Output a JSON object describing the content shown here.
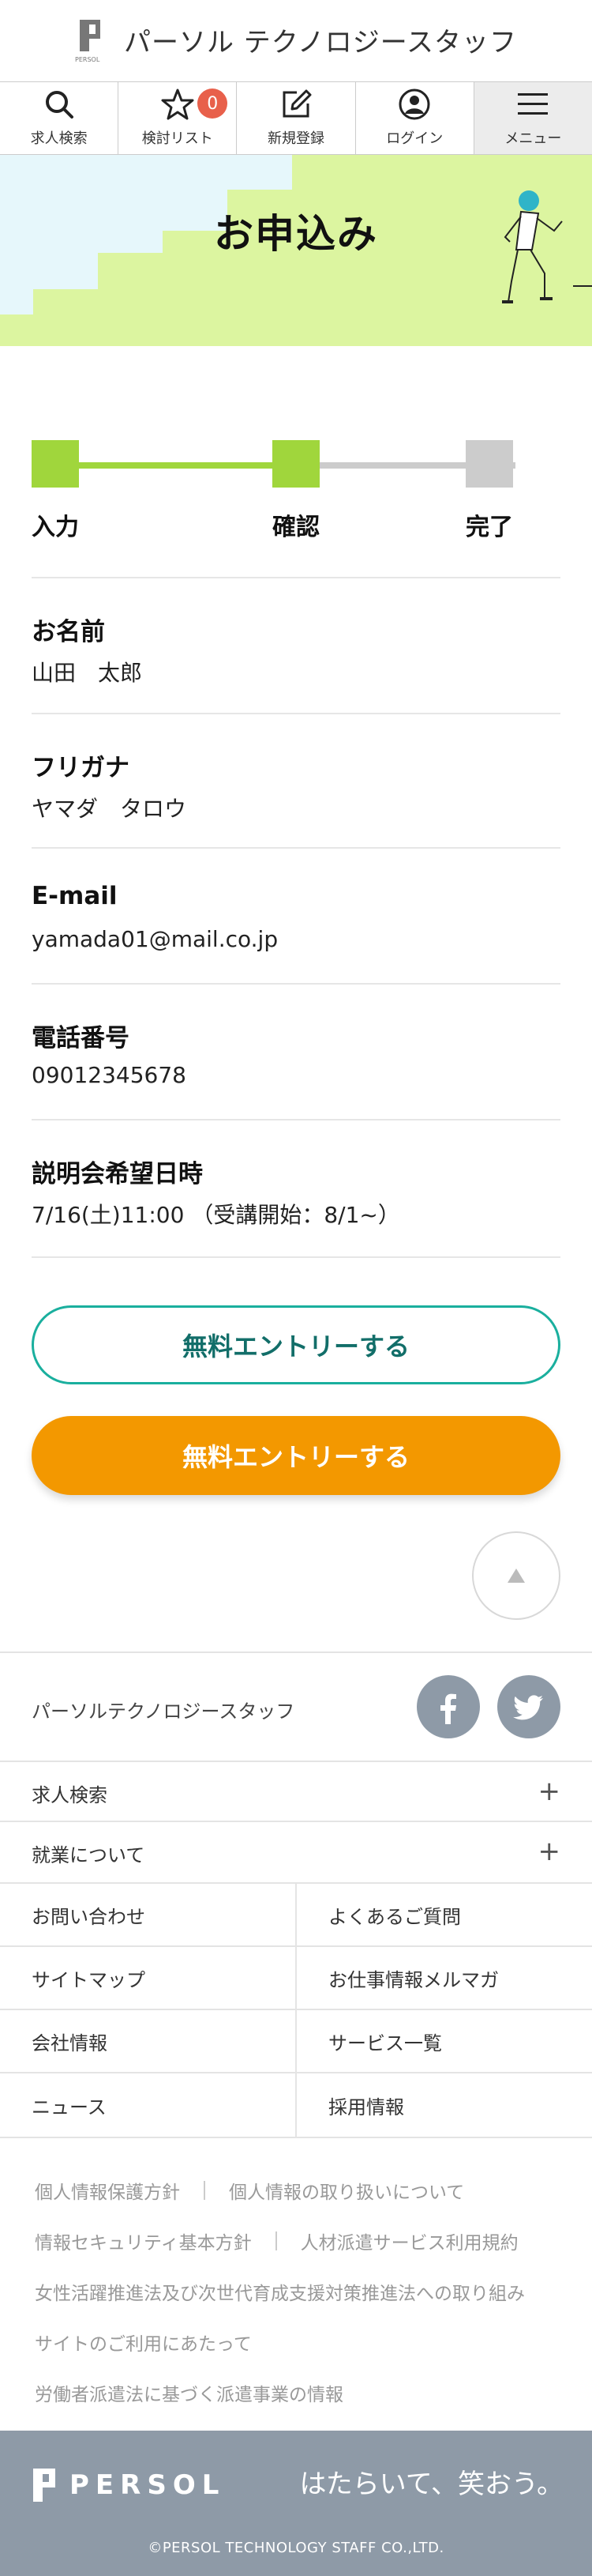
{
  "header": {
    "logo_mark_text": "PERSOL",
    "brand_name": "パーソル テクノロジースタッフ"
  },
  "nav": {
    "items": [
      {
        "label": "求人検索",
        "icon": "search-icon"
      },
      {
        "label": "検討リスト",
        "icon": "star-icon",
        "badge": "0"
      },
      {
        "label": "新規登録",
        "icon": "edit-icon"
      },
      {
        "label": "ログイン",
        "icon": "user-icon"
      },
      {
        "label": "メニュー",
        "icon": "menu-icon"
      }
    ]
  },
  "hero": {
    "title": "お申込み",
    "colors": {
      "sky": "#e6f7fb",
      "stairs": "#dcf5a0"
    }
  },
  "steps": {
    "items": [
      {
        "label": "入力",
        "status": "done"
      },
      {
        "label": "確認",
        "status": "current"
      },
      {
        "label": "完了",
        "status": "todo"
      }
    ],
    "colors": {
      "active": "#a0d63c",
      "inactive": "#cccccc"
    }
  },
  "form": {
    "fields": [
      {
        "label": "お名前",
        "value": "山田　太郎"
      },
      {
        "label": "フリガナ",
        "value": "ヤマダ　タロウ"
      },
      {
        "label": "E-mail",
        "value": "yamada01@mail.co.jp"
      },
      {
        "label": "電話番号",
        "value": "09012345678"
      },
      {
        "label": "説明会希望日時",
        "value": "7/16(土)11:00 （受講開始：8/1~）"
      }
    ]
  },
  "buttons": {
    "outline_label": "無料エントリーする",
    "solid_label": "無料エントリーする",
    "colors": {
      "outline": "#1aaf9e",
      "solid": "#f39800"
    }
  },
  "footer": {
    "company": "パーソルテクノロジースタッフ",
    "sns": [
      "facebook-icon",
      "twitter-icon"
    ],
    "accordions": [
      {
        "label": "求人検索"
      },
      {
        "label": "就業について"
      }
    ],
    "links": [
      [
        "お問い合わせ",
        "よくあるご質問"
      ],
      [
        "サイトマップ",
        "お仕事情報メルマガ"
      ],
      [
        "会社情報",
        "サービス一覧"
      ],
      [
        "ニュース",
        "採用情報"
      ]
    ],
    "sublinks": {
      "row1a": "個人情報保護方針",
      "row1b": "個人情報の取り扱いについて",
      "row2a": "情報セキュリティ基本方針",
      "row2b": "人材派遣サービス利用規約",
      "row3": "女性活躍推進法及び次世代育成支援対策推進法への取り組み",
      "row4": "サイトのご利用にあたって",
      "row5": "労働者派遣法に基づく派遣事業の情報"
    },
    "logo_text": "PERSOL",
    "catchcopy": "はたらいて、笑おう。",
    "copyright": "©PERSOL TECHNOLOGY STAFF CO.,LTD.",
    "bg_color": "#8e9aa7"
  }
}
